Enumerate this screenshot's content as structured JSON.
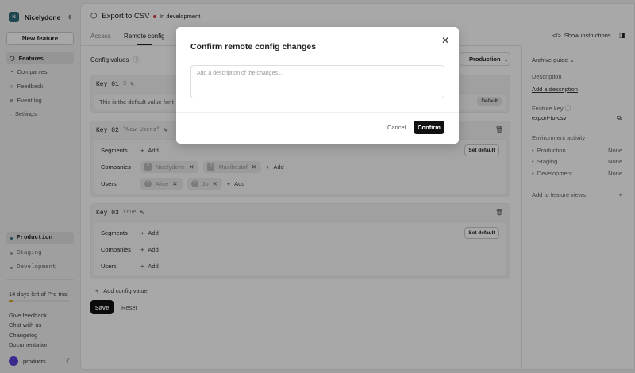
{
  "sidebar": {
    "org_initial": "N",
    "org": "Nicelydone",
    "new_feature": "New feature",
    "nav": [
      {
        "label": "Features",
        "icon": "box-icon"
      },
      {
        "label": "Companies",
        "icon": "pie-icon"
      },
      {
        "label": "Feedback",
        "icon": "chat-icon"
      },
      {
        "label": "Event log",
        "icon": "log-icon"
      },
      {
        "label": "Settings",
        "icon": "sliders-icon"
      }
    ],
    "envs": [
      "Production",
      "Staging",
      "Development"
    ],
    "trial": "14 days left of Pro trial",
    "trial_progress": 0.07,
    "links": [
      "Give feedback",
      "Chat with us",
      "Changelog",
      "Documentation"
    ],
    "user": "products"
  },
  "header": {
    "title": "Export to CSV",
    "status": "In development",
    "tabs": [
      "Access",
      "Remote config"
    ],
    "show_instructions": "Show instructions"
  },
  "config": {
    "title": "Config values",
    "env": "Production",
    "keys": [
      {
        "name": "Key 01",
        "value": "3",
        "default_text": "This is the default value for t",
        "default_badge": "Default"
      },
      {
        "name": "Key 02",
        "value": "\"New Users\"",
        "segments": "Segments",
        "companies": "Companies",
        "users": "Users",
        "add": "Add",
        "company_chips": [
          "Nicelydone",
          "Maxibestof"
        ],
        "user_chips": [
          "Alice",
          "Jo"
        ],
        "set_default": "Set default"
      },
      {
        "name": "Key 03",
        "value": "true",
        "segments": "Segments",
        "companies": "Companies",
        "users": "Users",
        "add": "Add",
        "set_default": "Set default"
      }
    ],
    "add_config": "Add config value",
    "save": "Save",
    "reset": "Reset"
  },
  "right": {
    "archive": "Archive guide",
    "desc_label": "Description",
    "desc_link": "Add a description",
    "key_label": "Feature key",
    "key": "export-to-csv",
    "env_label": "Environment activity",
    "envs": [
      {
        "name": "Production",
        "value": "None"
      },
      {
        "name": "Staging",
        "value": "None"
      },
      {
        "name": "Development",
        "value": "None"
      }
    ],
    "views": "Add to feature views"
  },
  "modal": {
    "title": "Confirm remote config changes",
    "placeholder": "Add a description of the changes...",
    "cancel": "Cancel",
    "confirm": "Confirm"
  }
}
